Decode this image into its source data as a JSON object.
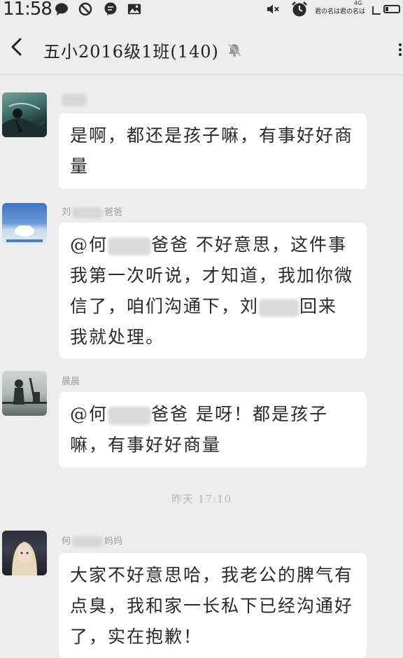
{
  "status_bar": {
    "time": "11:58",
    "carrier": "君の名は君の名は",
    "network": "4G",
    "icons": [
      "message-icon",
      "block-icon",
      "chat-icon",
      "image-icon",
      "mute-icon",
      "alarm-icon",
      "battery-icon"
    ]
  },
  "header": {
    "title": "五小2016级1班(140)",
    "icons": [
      "back-icon",
      "mute-icon",
      "more-icon"
    ]
  },
  "messages": [
    {
      "sender": "",
      "text": "是啊，都还是孩子嘛，有事好好商量"
    },
    {
      "sender_prefix": "刘",
      "sender_suffix": "爸爸",
      "text_a": "@何",
      "text_b": "爸爸  不好意思，这件事我第一次听说，才知道，我加你微信了，咱们沟通下，刘",
      "text_c": "回来我就处理。"
    },
    {
      "sender": "晨晨",
      "text_a": "@何",
      "text_b": "爸爸  是呀！都是孩子嘛，有事好好商量"
    },
    {
      "timestamp": "昨天 17:10"
    },
    {
      "sender_prefix": "何",
      "sender_suffix": "妈妈",
      "text": "大家不好意思哈，我老公的脾气有点臭，我和家一长私下已经沟通好了，实在抱歉！"
    }
  ]
}
